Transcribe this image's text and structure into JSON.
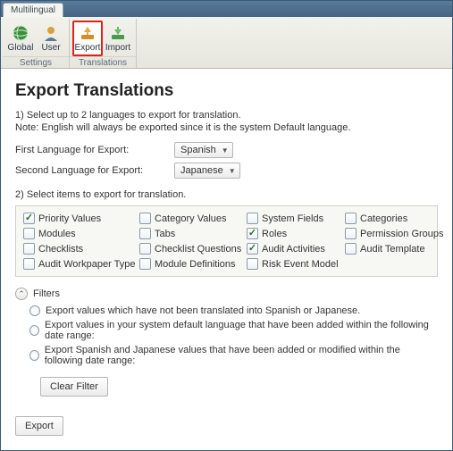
{
  "titlebar": {
    "tab": "Multilingual"
  },
  "ribbon": {
    "groups": [
      {
        "label": "Settings",
        "buttons": [
          {
            "label": "Global",
            "icon": "globe"
          },
          {
            "label": "User",
            "icon": "user"
          }
        ]
      },
      {
        "label": "Translations",
        "buttons": [
          {
            "label": "Export",
            "icon": "export",
            "selected": true
          },
          {
            "label": "Import",
            "icon": "import"
          }
        ]
      }
    ]
  },
  "heading": "Export Translations",
  "step1": {
    "text": "1) Select up to 2 languages to export for translation.",
    "note": "Note: English will always be exported since it is the system Default language."
  },
  "lang1": {
    "label": "First Language for Export:",
    "value": "Spanish"
  },
  "lang2": {
    "label": "Second Language for Export:",
    "value": "Japanese"
  },
  "step2": {
    "text": "2) Select items to export for translation."
  },
  "items": [
    {
      "label": "Priority Values",
      "checked": true
    },
    {
      "label": "Category Values",
      "checked": false
    },
    {
      "label": "System Fields",
      "checked": false
    },
    {
      "label": "Categories",
      "checked": false
    },
    {
      "label": "Modules",
      "checked": false
    },
    {
      "label": "Tabs",
      "checked": false
    },
    {
      "label": "Roles",
      "checked": true
    },
    {
      "label": "Permission Groups",
      "checked": false
    },
    {
      "label": "Checklists",
      "checked": false
    },
    {
      "label": "Checklist Questions",
      "checked": false
    },
    {
      "label": "Audit Activities",
      "checked": true
    },
    {
      "label": "Audit Template",
      "checked": false
    },
    {
      "label": "Audit Workpaper Type",
      "checked": false
    },
    {
      "label": "Module Definitions",
      "checked": false
    },
    {
      "label": "Risk Event Model",
      "checked": false
    }
  ],
  "filters": {
    "heading": "Filters",
    "options": [
      "Export values which have not been translated into Spanish or Japanese.",
      "Export values in your system default language that have been added within the following date range:",
      "Export Spanish and Japanese values that have been added or modified within the following date range:"
    ],
    "clear": "Clear Filter"
  },
  "export_btn": "Export"
}
